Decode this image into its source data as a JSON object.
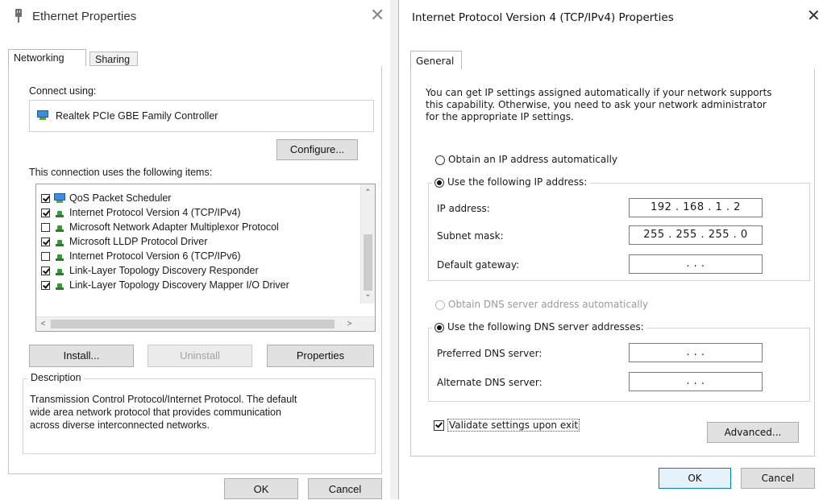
{
  "left": {
    "title": "Ethernet Properties",
    "tabs": [
      "Networking",
      "Sharing"
    ],
    "connect_using_label": "Connect using:",
    "adapter_name": "Realtek PCIe GBE Family Controller",
    "configure_label": "Configure...",
    "items_label": "This connection uses the following items:",
    "items": [
      {
        "label": "QoS Packet Scheduler",
        "checked": true,
        "icon": "monitor-icon"
      },
      {
        "label": "Internet Protocol Version 4 (TCP/IPv4)",
        "checked": true,
        "icon": "network-protocol-icon"
      },
      {
        "label": "Microsoft Network Adapter Multiplexor Protocol",
        "checked": false,
        "icon": "network-protocol-icon"
      },
      {
        "label": "Microsoft LLDP Protocol Driver",
        "checked": true,
        "icon": "network-protocol-icon"
      },
      {
        "label": "Internet Protocol Version 6 (TCP/IPv6)",
        "checked": false,
        "icon": "network-protocol-icon"
      },
      {
        "label": "Link-Layer Topology Discovery Responder",
        "checked": true,
        "icon": "network-protocol-icon"
      },
      {
        "label": "Link-Layer Topology Discovery Mapper I/O Driver",
        "checked": true,
        "icon": "network-protocol-icon"
      }
    ],
    "install_label": "Install...",
    "uninstall_label": "Uninstall",
    "properties_label": "Properties",
    "description_label": "Description",
    "description_lines": [
      "Transmission Control Protocol/Internet Protocol. The default",
      "wide area network protocol that provides communication",
      "across diverse interconnected networks."
    ],
    "ok_label": "OK",
    "cancel_label": "Cancel"
  },
  "right": {
    "title": "Internet Protocol Version 4 (TCP/IPv4) Properties",
    "tab": "General",
    "intro_lines": [
      "You can get IP settings assigned automatically if your network supports",
      "this capability. Otherwise, you need to ask your network administrator",
      "for the appropriate IP settings."
    ],
    "obtain_ip_auto": "Obtain an IP address automatically",
    "use_following_ip": "Use the following IP address:",
    "ip_address_label": "IP address:",
    "ip_address_value": "192 . 168 .  1  .  2",
    "subnet_label": "Subnet mask:",
    "subnet_value": "255 . 255 . 255 .  0",
    "gateway_label": "Default gateway:",
    "gateway_value": ".        .        .",
    "obtain_dns_auto": "Obtain DNS server address automatically",
    "use_following_dns": "Use the following DNS server addresses:",
    "preferred_dns_label": "Preferred DNS server:",
    "preferred_dns_value": ".        .        .",
    "alternate_dns_label": "Alternate DNS server:",
    "alternate_dns_value": ".        .        .",
    "validate_label": "Validate settings upon exit",
    "advanced_label": "Advanced...",
    "ok_label": "OK",
    "cancel_label": "Cancel"
  },
  "colors": {
    "accent_border": "#0078d7",
    "dialog_bg": "#ffffff",
    "button_face": "#e1e1e1"
  }
}
